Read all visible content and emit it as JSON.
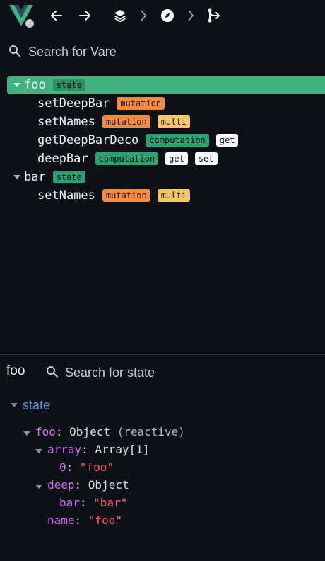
{
  "toolbar": {
    "logo_icon": "vue-logo-icon",
    "back_icon": "arrow-left-icon",
    "forward_icon": "arrow-right-icon",
    "components_icon": "layers-icon",
    "timeline_icon": "compass-icon",
    "routes_icon": "route-icon"
  },
  "top_search": {
    "placeholder": "Search for Vare"
  },
  "tree": {
    "foo": {
      "label": "foo",
      "tag": "state",
      "children": [
        {
          "label": "setDeepBar",
          "tags": [
            "mutation"
          ]
        },
        {
          "label": "setNames",
          "tags": [
            "mutation",
            "multi"
          ]
        },
        {
          "label": "getDeepBarDeco",
          "tags": [
            "computation",
            "get"
          ]
        },
        {
          "label": "deepBar",
          "tags": [
            "computation",
            "get",
            "set"
          ]
        }
      ]
    },
    "bar": {
      "label": "bar",
      "tag": "state",
      "children": [
        {
          "label": "setNames",
          "tags": [
            "mutation",
            "multi"
          ]
        }
      ]
    }
  },
  "inspector": {
    "title": "foo",
    "search_placeholder": "Search for state",
    "section": "state",
    "rows": {
      "foo_key": "foo",
      "foo_type": "Object",
      "foo_note": "(reactive)",
      "array_key": "array",
      "array_type": "Array[1]",
      "array_0_key": "0",
      "array_0_val": "\"foo\"",
      "deep_key": "deep",
      "deep_type": "Object",
      "bar_key": "bar",
      "bar_val": "\"bar\"",
      "name_key": "name",
      "name_val": "\"foo\""
    }
  },
  "colors": {
    "background": "#0d1117",
    "selected": "#3fb27f",
    "mutation": "#f28c45",
    "multi": "#f5c76a",
    "computation": "#2da16f",
    "key": "#d56ef5",
    "string": "#ff5c5c",
    "section": "#5e8fd6"
  }
}
